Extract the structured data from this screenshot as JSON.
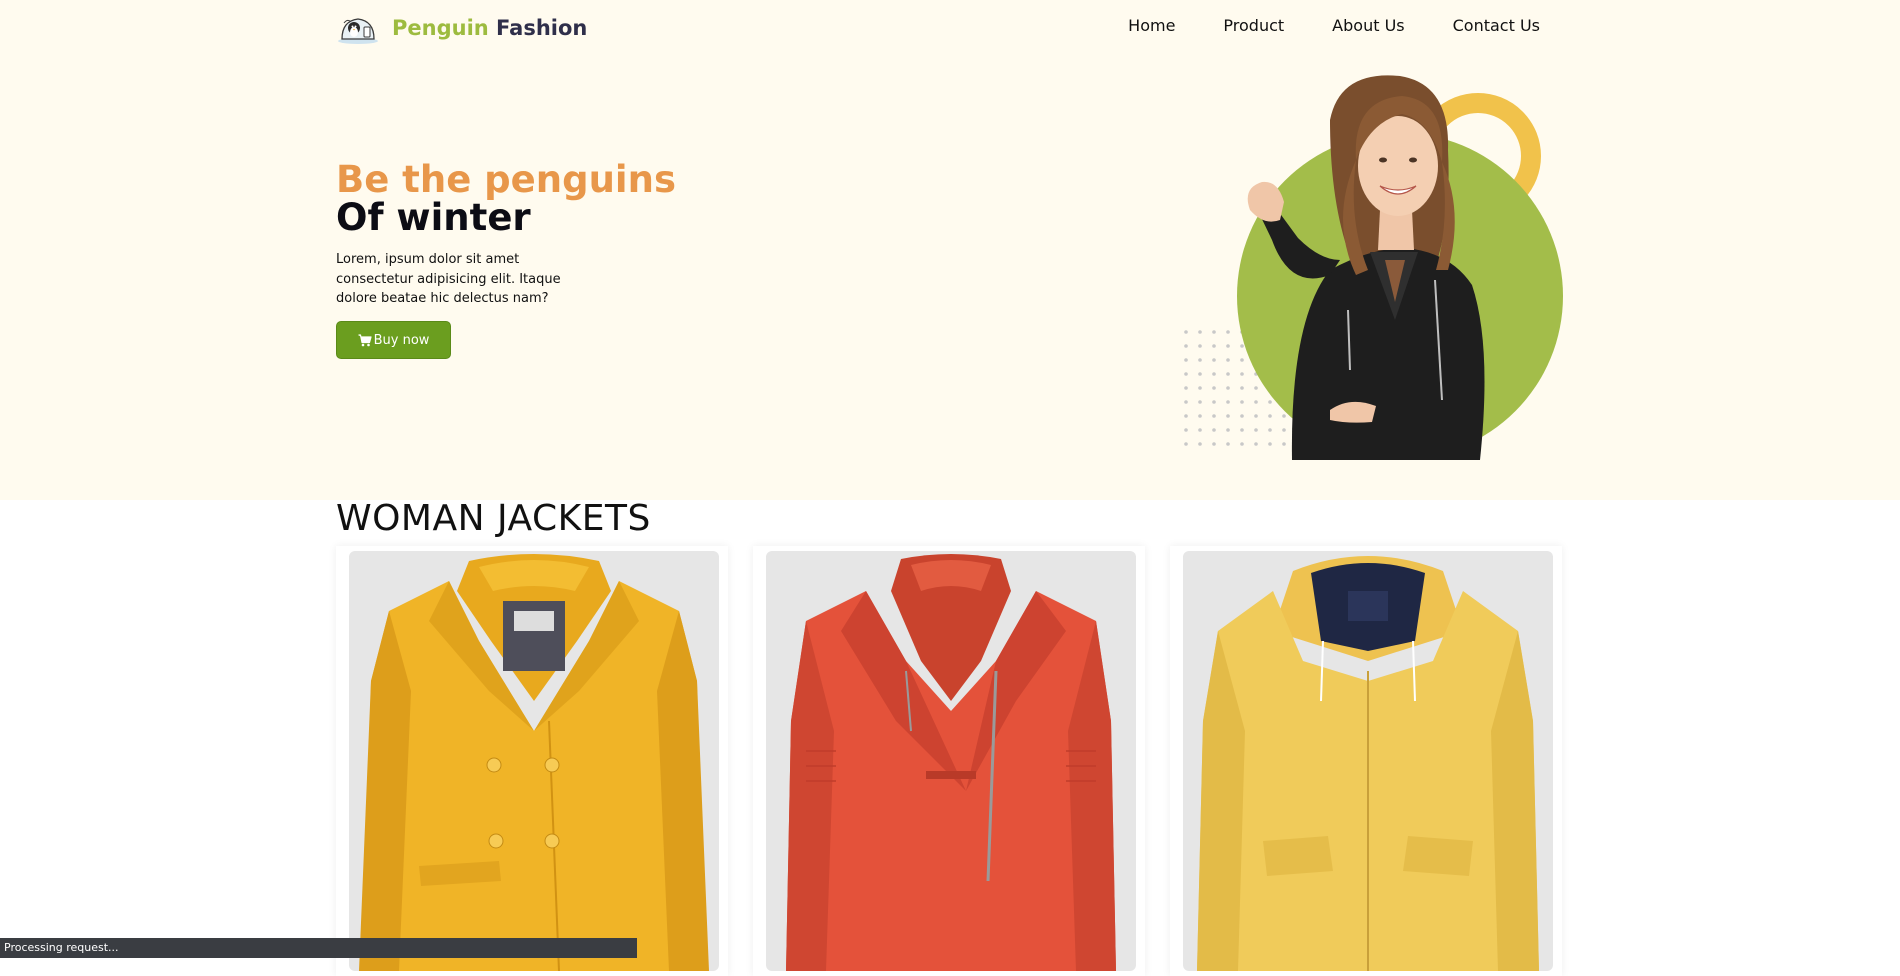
{
  "header": {
    "logo_accent": "Penguin",
    "logo_rest": "Fashion",
    "nav": [
      "Home",
      "Product",
      "About Us",
      "Contact Us"
    ]
  },
  "hero": {
    "headline_line1": "Be the penguins",
    "headline_line2": "Of winter",
    "description": "Lorem, ipsum dolor sit amet consectetur adipisicing elit. Itaque dolore beatae hic delectus nam?",
    "button_label": "Buy now",
    "button_icon": "cart-icon"
  },
  "section": {
    "title": "WOMAN JACKETS",
    "products": [
      {
        "image": "yellow-wool-peacoat"
      },
      {
        "image": "red-leather-biker-jacket"
      },
      {
        "image": "yellow-hooded-parka"
      }
    ]
  },
  "status_bar": {
    "text": "Processing request..."
  },
  "colors": {
    "hero_bg": "#fffbef",
    "accent_green": "#9dbb3f",
    "button_green": "#6b9e1f",
    "headline_orange": "#e8974a",
    "ring_yellow": "#f1c24b"
  }
}
